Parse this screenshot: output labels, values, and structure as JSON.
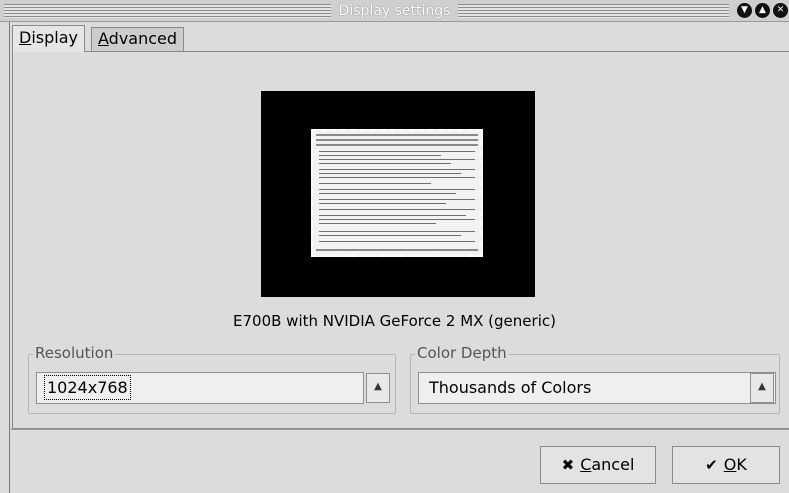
{
  "window": {
    "title": "Display settings"
  },
  "tabs": [
    {
      "label": "Display",
      "mnemonic": "D",
      "rest": "isplay"
    },
    {
      "label": "Advanced",
      "mnemonic": "A",
      "rest": "dvanced"
    }
  ],
  "monitor": {
    "caption": "E700B with NVIDIA GeForce 2 MX (generic)"
  },
  "resolution": {
    "label": "Resolution",
    "selected": "1024x768"
  },
  "color_depth": {
    "label": "Color Depth",
    "selected": "Thousands of Colors"
  },
  "buttons": {
    "cancel": {
      "mnemonic": "C",
      "rest": "ancel",
      "label": "Cancel",
      "icon": "cancel-x-icon"
    },
    "ok": {
      "mnemonic": "O",
      "rest": "K",
      "label": "OK",
      "icon": "checkmark-icon"
    }
  }
}
